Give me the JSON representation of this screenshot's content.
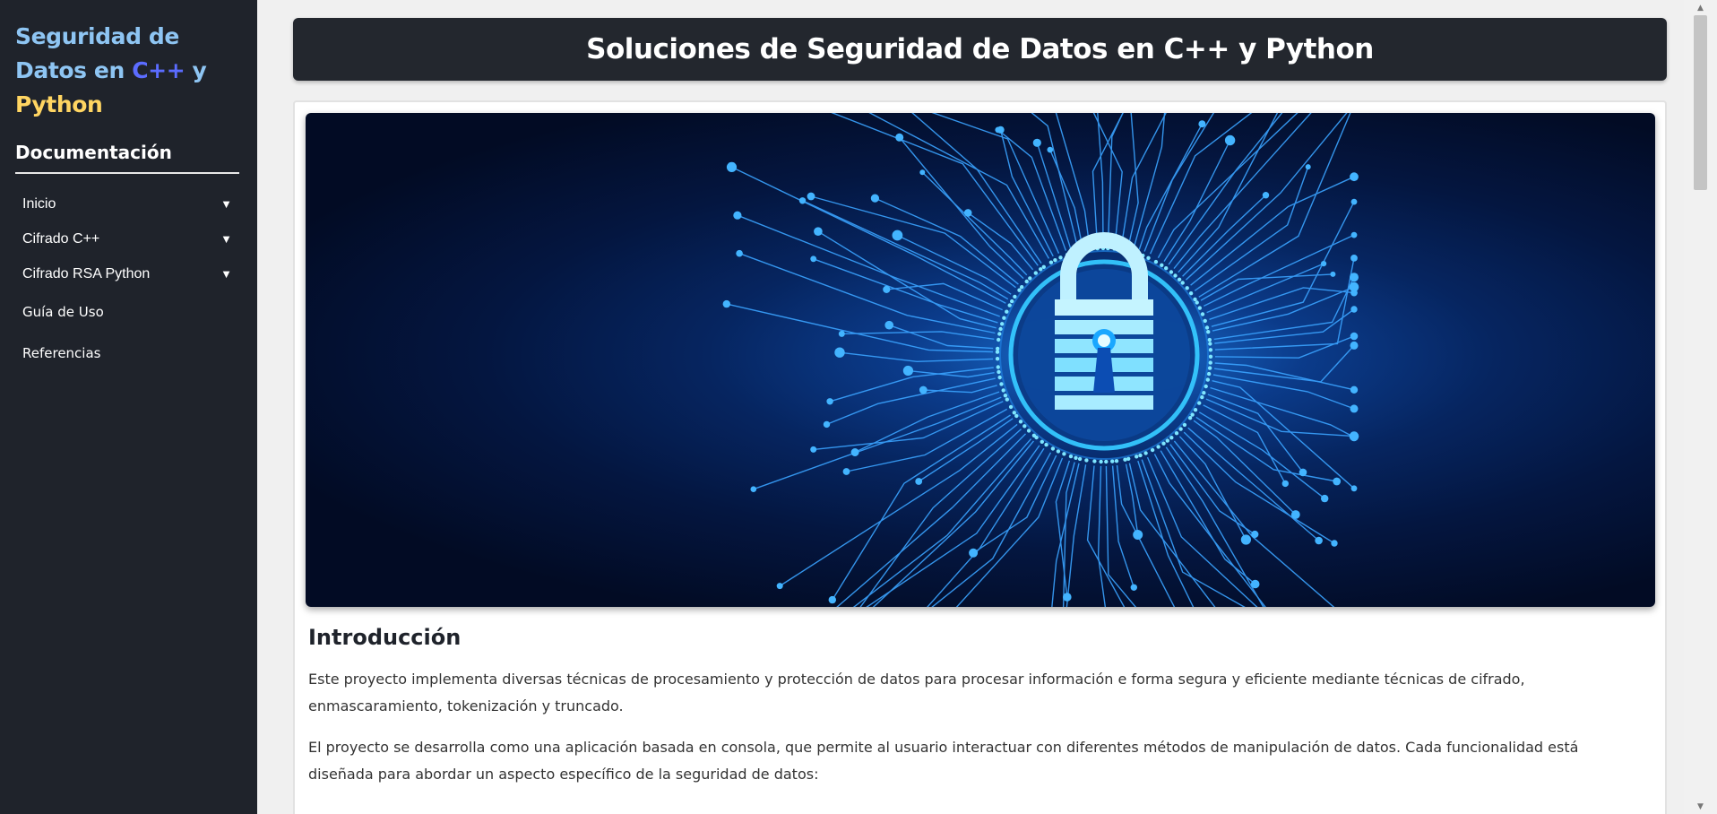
{
  "sidebar": {
    "brand": {
      "part1": "Seguridad de Datos en ",
      "part2": "C++",
      "part3": " y ",
      "part4": "Python"
    },
    "heading": "Documentación",
    "items": [
      {
        "label": "Inicio",
        "caret": "▼"
      },
      {
        "label": "Cifrado C++",
        "caret": "▼"
      },
      {
        "label": "Cifrado RSA Python",
        "caret": "▼"
      },
      {
        "label": "Guía de Uso"
      },
      {
        "label": "Referencias"
      }
    ]
  },
  "header": {
    "title": "Soluciones de Seguridad de Datos en C++ y Python"
  },
  "content": {
    "hero_icon": "padlock-circuit-image",
    "intro_title": "Introducción",
    "paragraphs": [
      "Este proyecto implementa diversas técnicas de procesamiento y protección de datos para procesar información e forma segura y eficiente mediante técnicas de cifrado, enmascaramiento, tokenización y truncado.",
      "El proyecto se desarrolla como una aplicación basada en consola, que permite al usuario interactuar con diferentes métodos de manipulación de datos. Cada funcionalidad está diseñada para abordar un aspecto específico de la seguridad de datos:"
    ]
  },
  "colors": {
    "sidebar_bg": "#1f232b",
    "brand_blue": "#8ec5f3",
    "brand_cpp": "#5b6cff",
    "brand_python": "#ffd562",
    "header_bg": "#23272e"
  }
}
